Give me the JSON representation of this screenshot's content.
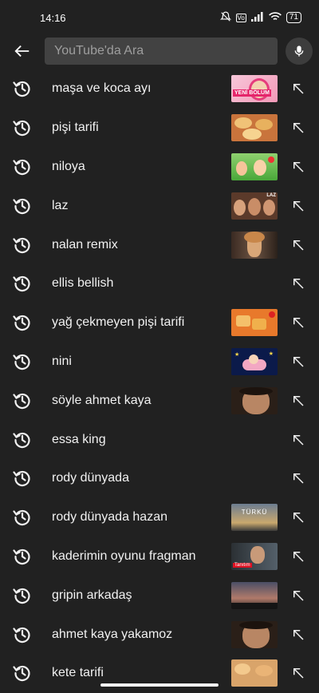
{
  "status": {
    "time": "14:16",
    "battery": "71",
    "network_badge": "Vo"
  },
  "search": {
    "placeholder": "YouTube'da Ara"
  },
  "icons": {
    "back": "arrow-left-icon",
    "mic": "microphone-icon",
    "history": "history-clock-icon",
    "fill": "arrow-up-left-icon"
  },
  "history": [
    {
      "label": "maşa ve koca ayı",
      "thumb": "masha",
      "thumb_text": "YENİ BÖLÜM"
    },
    {
      "label": "pişi tarifi",
      "thumb": "food1",
      "thumb_text": ""
    },
    {
      "label": "niloya",
      "thumb": "cartoon",
      "thumb_text": ""
    },
    {
      "label": "laz",
      "thumb": "faces",
      "thumb_text": "LAZ"
    },
    {
      "label": "nalan remix",
      "thumb": "girl",
      "thumb_text": ""
    },
    {
      "label": "ellis bellish",
      "thumb": "none",
      "thumb_text": ""
    },
    {
      "label": "yağ çekmeyen pişi tarifi",
      "thumb": "food2",
      "thumb_text": ""
    },
    {
      "label": "nini",
      "thumb": "baby",
      "thumb_text": ""
    },
    {
      "label": "söyle ahmet kaya",
      "thumb": "man",
      "thumb_text": ""
    },
    {
      "label": "essa king",
      "thumb": "none",
      "thumb_text": ""
    },
    {
      "label": "rody dünyada",
      "thumb": "none",
      "thumb_text": ""
    },
    {
      "label": "rody dünyada hazan",
      "thumb": "sky",
      "thumb_text": "TÜRKÜ"
    },
    {
      "label": "kaderimin oyunu fragman",
      "thumb": "drama",
      "thumb_text": "Tanıtım"
    },
    {
      "label": "gripin arkadaş",
      "thumb": "scene",
      "thumb_text": ""
    },
    {
      "label": "ahmet kaya yakamoz",
      "thumb": "man",
      "thumb_text": ""
    },
    {
      "label": "kete tarifi",
      "thumb": "food3",
      "thumb_text": ""
    }
  ],
  "colors": {
    "background": "#212121",
    "search_bg": "#424242",
    "text": "#f1f1f1"
  }
}
